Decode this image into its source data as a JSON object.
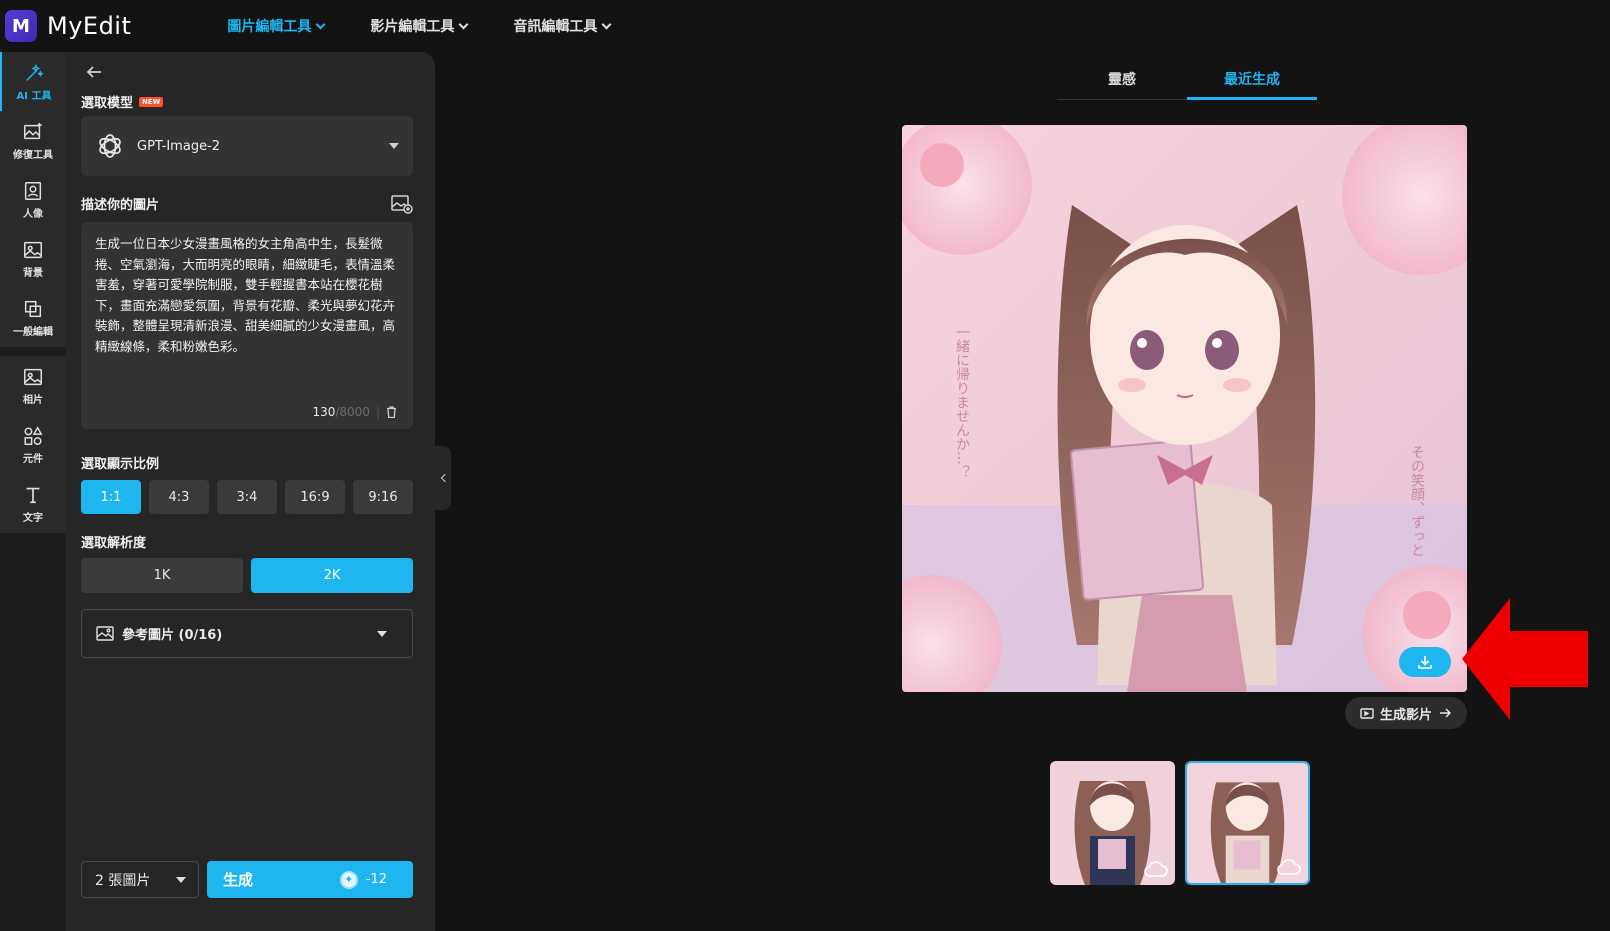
{
  "app": {
    "name": "MyEdit",
    "logo_letter": "M"
  },
  "topnav": [
    {
      "label": "圖片編輯工具",
      "active": true
    },
    {
      "label": "影片編輯工具",
      "active": false
    },
    {
      "label": "音訊編輯工具",
      "active": false
    }
  ],
  "sidebar": {
    "items": [
      {
        "label": "AI 工具",
        "icon": "magic-wand-icon",
        "active": true
      },
      {
        "label": "修復工具",
        "icon": "image-sparkle-icon",
        "active": false
      },
      {
        "label": "人像",
        "icon": "portrait-icon",
        "active": false
      },
      {
        "label": "背景",
        "icon": "background-icon",
        "active": false
      },
      {
        "label": "一般編輯",
        "icon": "crop-icon",
        "active": false
      },
      {
        "label": "相片",
        "icon": "photo-icon",
        "active": false
      },
      {
        "label": "元件",
        "icon": "shapes-icon",
        "active": false
      },
      {
        "label": "文字",
        "icon": "text-icon",
        "active": false
      }
    ]
  },
  "panel": {
    "model_title": "選取模型",
    "new_badge": "NEW",
    "model_name": "GPT-Image-2",
    "describe_title": "描述你的圖片",
    "prompt": "生成一位日本少女漫畫風格的女主角高中生，長髮微捲、空氣瀏海，大而明亮的眼睛，細緻睫毛，表情溫柔害羞，穿著可愛學院制服，雙手輕握書本站在櫻花樹下，畫面充滿戀愛氛圍，背景有花瓣、柔光與夢幻花卉裝飾，整體呈現清新浪漫、甜美細膩的少女漫畫風，高精緻線條，柔和粉嫩色彩。",
    "char_count": "130",
    "char_max": "/8000",
    "char_sep": "|",
    "ratio_title": "選取顯示比例",
    "ratios": [
      {
        "label": "1:1",
        "active": true
      },
      {
        "label": "4:3",
        "active": false
      },
      {
        "label": "3:4",
        "active": false
      },
      {
        "label": "16:9",
        "active": false
      },
      {
        "label": "9:16",
        "active": false
      }
    ],
    "resolution_title": "選取解析度",
    "resolutions": [
      {
        "label": "1K",
        "active": false
      },
      {
        "label": "2K",
        "active": true
      }
    ],
    "reference_label": "參考圖片 (0/16)",
    "image_count": "2 張圖片",
    "generate_label": "生成",
    "generate_cost": "-12"
  },
  "main": {
    "tabs": [
      {
        "label": "靈感",
        "active": false
      },
      {
        "label": "最近生成",
        "active": true
      }
    ],
    "generate_video_label": "生成影片",
    "thumbnails": [
      {
        "selected": false
      },
      {
        "selected": true
      }
    ]
  },
  "colors": {
    "accent": "#1fb5ee",
    "arrow": "#ee0000",
    "bg": "#131313",
    "panel": "#262626"
  }
}
